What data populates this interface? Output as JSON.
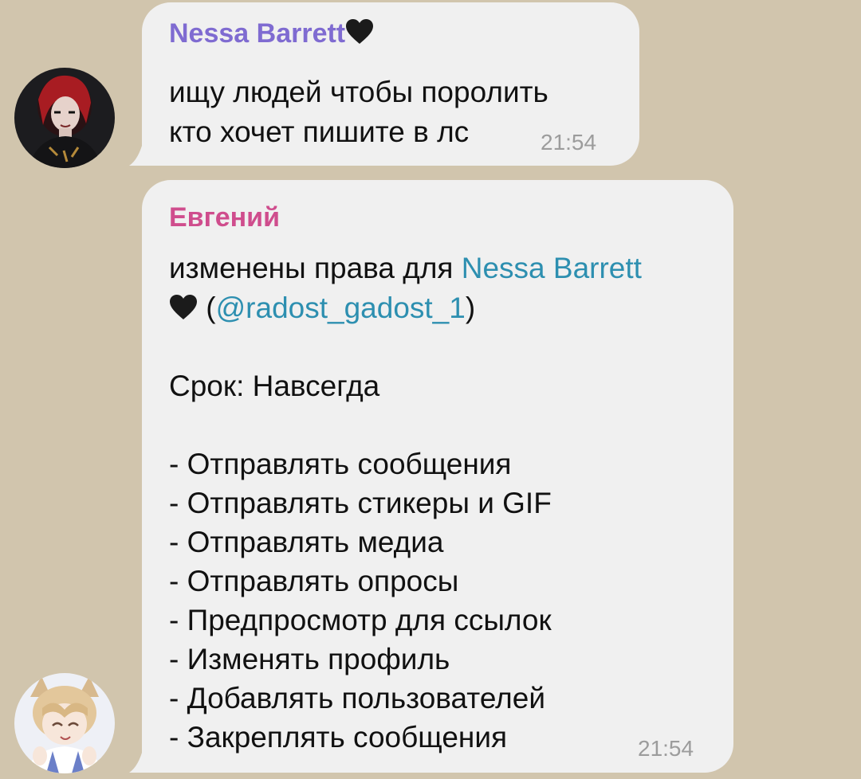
{
  "messages": [
    {
      "sender": "Nessa Barrett",
      "sender_emoji": "black-heart",
      "lines": [
        "ищу людей чтобы поролить",
        "кто хочет пишите в лс"
      ],
      "time": "21:54",
      "avatar": "girl-red-hair-avatar"
    },
    {
      "sender": "Евгений",
      "intro": "изменены права для",
      "target_name": "Nessa Barrett",
      "target_emoji": "black-heart",
      "open_paren": "(",
      "target_username": "@radost_gadost_1",
      "close_paren": ")",
      "term": "Срок: Навсегда",
      "rights": [
        "- Отправлять сообщения",
        "- Отправлять стикеры и GIF",
        "- Отправлять медиа",
        "- Отправлять опросы",
        "- Предпросмотр для ссылок",
        "- Изменять профиль",
        "- Добавлять пользователей",
        "- Закреплять сообщения"
      ],
      "time": "21:54",
      "avatar": "anime-catboy-avatar"
    }
  ],
  "colors": {
    "background": "#d1c5ad",
    "bubble": "#f0f0f0",
    "sender_nessa": "#7f6bd1",
    "sender_evgeny": "#cf4d8d",
    "link": "#2d8fb0",
    "time": "#9c9c9c"
  }
}
